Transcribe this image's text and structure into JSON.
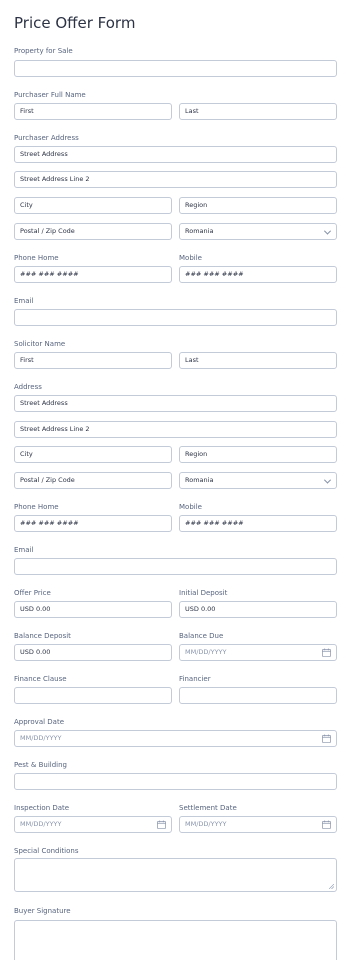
{
  "title": "Price Offer Form",
  "property": {
    "label": "Property for Sale",
    "value": ""
  },
  "purchaser": {
    "name_label": "Purchaser Full Name",
    "first": "First",
    "last": "Last",
    "address_label": "Purchaser Address",
    "street": "Street Address",
    "street2": "Street Address Line 2",
    "city": "City",
    "region": "Region",
    "postal": "Postal / Zip Code",
    "country": "Romania",
    "phone_home_label": "Phone Home",
    "phone_home": "### ### ####",
    "mobile_label": "Mobile",
    "mobile": "### ### ####",
    "email_label": "Email",
    "email": ""
  },
  "solicitor": {
    "name_label": "Solicitor Name",
    "first": "First",
    "last": "Last",
    "address_label": "Address",
    "street": "Street Address",
    "street2": "Street Address Line 2",
    "city": "City",
    "region": "Region",
    "postal": "Postal / Zip Code",
    "country": "Romania",
    "phone_home_label": "Phone Home",
    "phone_home": "### ### ####",
    "mobile_label": "Mobile",
    "mobile": "### ### ####",
    "email_label": "Email",
    "email": ""
  },
  "offer": {
    "price_label": "Offer Price",
    "price": "USD  0.00",
    "deposit_label": "Initial Deposit",
    "deposit": "USD  0.00",
    "balance_label": "Balance Deposit",
    "balance": "USD  0.00",
    "due_label": "Balance Due",
    "due": "MM/DD/YYYY",
    "finance_label": "Finance Clause",
    "financier_label": "Financier",
    "approval_label": "Approval Date",
    "approval": "MM/DD/YYYY",
    "pest_label": "Pest & Building",
    "inspection_label": "Inspection Date",
    "inspection": "MM/DD/YYYY",
    "settlement_label": "Settlement Date",
    "settlement": "MM/DD/YYYY",
    "special_label": "Special Conditions",
    "signature_label": "Buyer Signature"
  },
  "icons": {
    "calendar": "calendar-icon",
    "dropdown": "chevron-down-icon"
  }
}
